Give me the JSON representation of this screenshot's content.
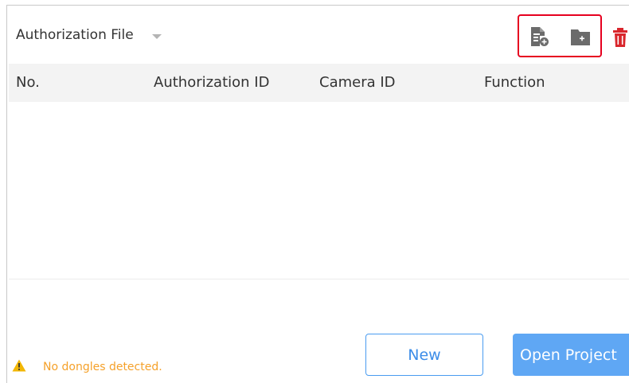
{
  "panel": {
    "title": "Authorization File",
    "title_dropdown_icon": "caret-down-icon"
  },
  "toolbar": {
    "import_icon": "import-file-icon",
    "new_folder_icon": "new-folder-icon",
    "delete_icon": "delete-icon",
    "highlight_color": "#e6001f",
    "delete_color": "#d9262c"
  },
  "table": {
    "columns": [
      "No.",
      "Authorization ID",
      "Camera ID",
      "Function"
    ],
    "rows": []
  },
  "status": {
    "icon": "warning-icon",
    "message": "No dongles detected.",
    "color": "#f5a12a"
  },
  "buttons": {
    "new_label": "New",
    "open_project_label": "Open Project",
    "accent": "#4a9cf0"
  }
}
